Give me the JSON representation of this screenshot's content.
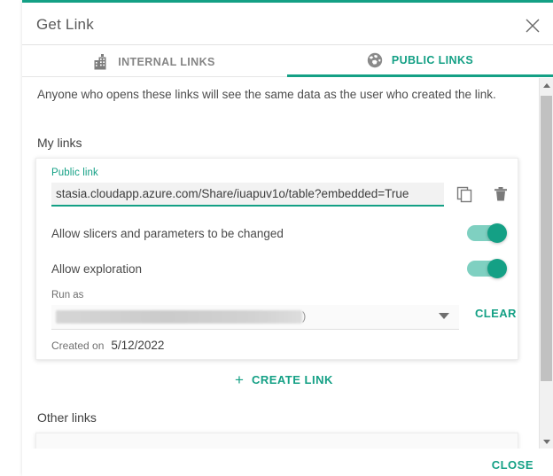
{
  "dialog": {
    "title": "Get Link",
    "close_icon": "close-icon"
  },
  "tabs": [
    {
      "label": "INTERNAL LINKS",
      "icon": "building-icon",
      "active": false
    },
    {
      "label": "PUBLIC LINKS",
      "icon": "globe-icon",
      "active": true
    }
  ],
  "body": {
    "intro": "Anyone who opens these links will see the same data as the user who created the link.",
    "my_links_title": "My links",
    "other_links_title": "Other links"
  },
  "link_card": {
    "public_link_label": "Public link",
    "url_value": "stasia.cloudapp.azure.com/Share/iuapuv1o/table?embedded=True",
    "copy_icon": "copy-icon",
    "delete_icon": "trash-icon",
    "toggles": [
      {
        "label": "Allow slicers and parameters to be changed",
        "state": "on"
      },
      {
        "label": "Allow exploration",
        "state": "on"
      }
    ],
    "run_as_label": "Run as",
    "run_as_value": "",
    "run_as_suffix": ")",
    "clear_label": "CLEAR",
    "created_on_label": "Created on",
    "created_on_value": "5/12/2022"
  },
  "create_link": {
    "plus": "+",
    "label": "CREATE LINK"
  },
  "footer": {
    "close_label": "CLOSE"
  },
  "colors": {
    "accent": "#14a085",
    "toggle_track": "#7fd0c1",
    "text": "#4a4a4a",
    "muted": "#858585"
  }
}
